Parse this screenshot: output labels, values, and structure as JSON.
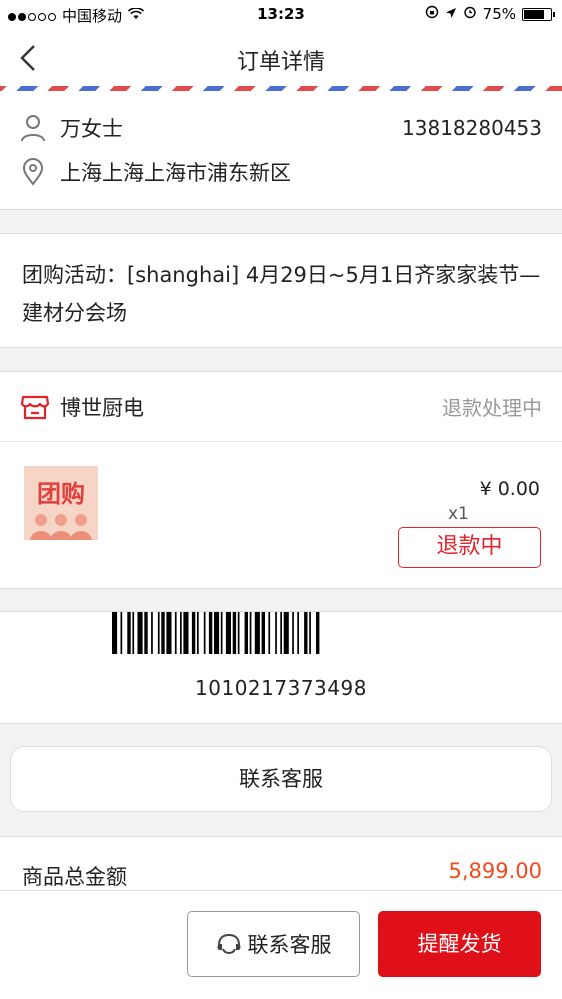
{
  "status_bar": {
    "carrier": "中国移动",
    "time": "13:23",
    "battery": "75%",
    "battery_level": 0.75
  },
  "nav": {
    "title": "订单详情"
  },
  "address": {
    "name": "万女士",
    "phone": "13818280453",
    "location": "上海上海上海市浦东新区"
  },
  "group_buy": {
    "text": "团购活动：[shanghai] 4月29日~5月1日齐家家装节—建材分会场"
  },
  "shop": {
    "name": "博世厨电",
    "status": "退款处理中"
  },
  "product": {
    "thumb_text": "团购",
    "price": "¥  0.00",
    "quantity": "x1",
    "refund_tag": "退款中"
  },
  "barcode": {
    "number": "1010217373498"
  },
  "contact_service_label": "联系客服",
  "total": {
    "label": "商品总金额",
    "value": "5,899.00"
  },
  "bottom": {
    "service_label": "联系客服",
    "remind_label": "提醒发货"
  },
  "colors": {
    "accent": "#e01018",
    "price": "#f04a1c"
  }
}
